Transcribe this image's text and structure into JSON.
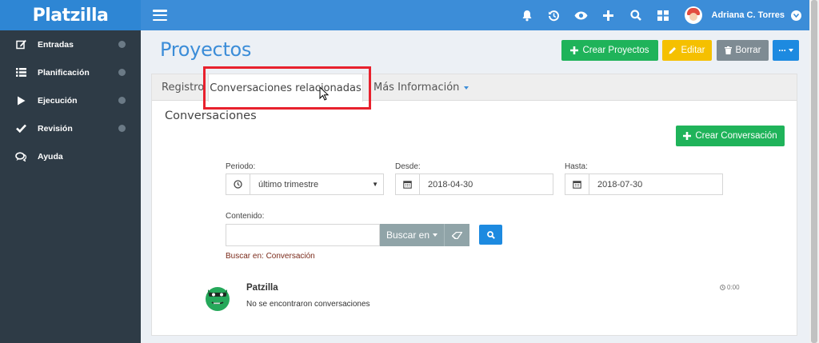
{
  "app": {
    "logo": "Platzilla",
    "brand_color": "#2e86d4",
    "topbar_color": "#3c8dd8",
    "sidebar_color": "#2e3b46"
  },
  "topbar": {
    "icons": [
      "bell-icon",
      "history-icon",
      "eye-icon",
      "plus-icon",
      "search-icon",
      "grid-icon"
    ],
    "user_name": "Adriana C. Torres"
  },
  "sidebar": {
    "items": [
      {
        "label": "Entradas",
        "icon": "edit-icon"
      },
      {
        "label": "Planificación",
        "icon": "list-icon"
      },
      {
        "label": "Ejecución",
        "icon": "play-icon"
      },
      {
        "label": "Revisión",
        "icon": "check-icon"
      },
      {
        "label": "Ayuda",
        "icon": "chat-icon"
      }
    ]
  },
  "page": {
    "title": "Proyectos"
  },
  "toolbar": {
    "create_label": "Crear Proyectos",
    "edit_label": "Editar",
    "delete_label": "Borrar",
    "more_label": "..."
  },
  "tabs": [
    {
      "label": "Registro"
    },
    {
      "label": "Conversaciones relacionadas",
      "active": true
    },
    {
      "label": "Más Información"
    }
  ],
  "conversations": {
    "title": "Conversaciones",
    "create_label": "Crear Conversación",
    "filters": {
      "period_label": "Periodo:",
      "period_value": "último trimestre",
      "from_label": "Desde:",
      "from_value": "2018-04-30",
      "to_label": "Hasta:",
      "to_value": "2018-07-30",
      "content_label": "Contenido:",
      "content_value": "",
      "search_in_label": "Buscar en",
      "search_hint": "Buscar en: Conversación"
    },
    "list": [
      {
        "name": "Patzilla",
        "message": "No se encontraron conversaciones",
        "time": "0:00"
      }
    ]
  }
}
